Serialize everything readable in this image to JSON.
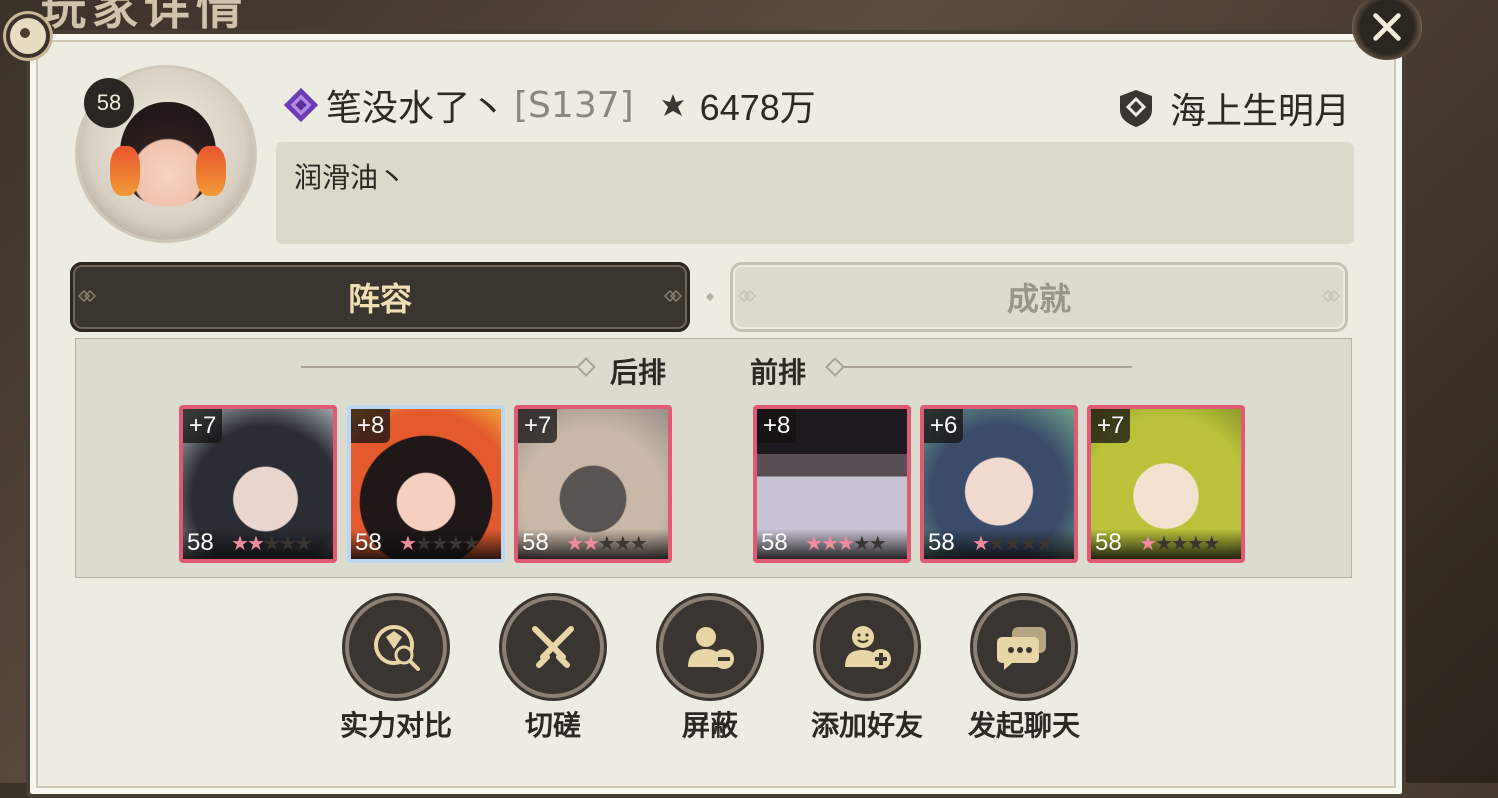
{
  "background_title": "玩家详情",
  "profile": {
    "level": "58",
    "name": "笔没水了丶",
    "server": "[S137]",
    "power": "6478万",
    "guild": "海上生明月",
    "signature": "润滑油丶"
  },
  "tabs": [
    {
      "label": "阵容",
      "active": true
    },
    {
      "label": "成就",
      "active": false
    }
  ],
  "lineup": {
    "back_row_label": "后排",
    "front_row_label": "前排",
    "back_row": [
      {
        "plus": "+7",
        "level": "58",
        "stars": 2,
        "portrait": "dark-hair-woman"
      },
      {
        "plus": "+8",
        "level": "58",
        "stars": 1,
        "portrait": "red-eyed-girl",
        "rainbow": true
      },
      {
        "plus": "+7",
        "level": "58",
        "stars": 2,
        "portrait": "masked-grey-hair"
      }
    ],
    "front_row": [
      {
        "plus": "+8",
        "level": "58",
        "stars": 3,
        "portrait": "hat-white-hair"
      },
      {
        "plus": "+6",
        "level": "58",
        "stars": 1,
        "portrait": "pink-glasses"
      },
      {
        "plus": "+7",
        "level": "58",
        "stars": 1,
        "portrait": "green-hair-girl"
      }
    ]
  },
  "actions": [
    {
      "label": "实力对比",
      "icon": "compare-power-icon"
    },
    {
      "label": "切磋",
      "icon": "crossed-swords-icon"
    },
    {
      "label": "屏蔽",
      "icon": "block-user-icon"
    },
    {
      "label": "添加好友",
      "icon": "add-friend-icon"
    },
    {
      "label": "发起聊天",
      "icon": "chat-bubble-icon"
    }
  ],
  "colors": {
    "panel": "#eeebe3",
    "active_tab": "#3b352f",
    "active_tab_text": "#f1dfb6",
    "card_border": "#e05a73",
    "star": "#f28aa0"
  }
}
